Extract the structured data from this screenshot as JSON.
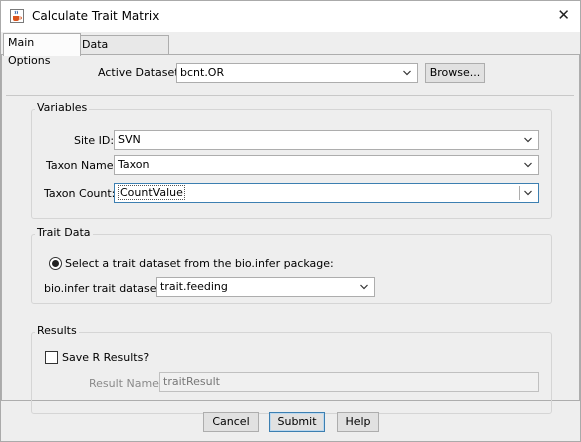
{
  "window": {
    "title": "Calculate Trait Matrix",
    "close_glyph": "✕"
  },
  "tabs": [
    {
      "label": "Main Options",
      "active": true
    },
    {
      "label": "Data Subsetting",
      "active": false
    }
  ],
  "active_dataset": {
    "label": "Active Dataset:",
    "value": "bcnt.OR",
    "browse_label": "Browse..."
  },
  "variables": {
    "title": "Variables",
    "site_id": {
      "label": "Site ID:",
      "value": "SVN"
    },
    "taxon_name": {
      "label": "Taxon Name:",
      "value": "Taxon"
    },
    "taxon_count": {
      "label": "Taxon Count:",
      "value": "CountValue"
    }
  },
  "trait_data": {
    "title": "Trait Data",
    "radio_label": "Select a trait dataset from the bio.infer package:",
    "radio_selected": true,
    "dataset_label": "bio.infer trait dataset:",
    "dataset_value": "trait.feeding"
  },
  "results": {
    "title": "Results",
    "save_label": "Save R Results?",
    "save_checked": false,
    "result_name_label": "Result Name:",
    "result_name_value": "traitResult"
  },
  "buttons": {
    "cancel": "Cancel",
    "submit": "Submit",
    "help": "Help"
  },
  "icons": {
    "app": "java-cup-icon",
    "dropdown": "chevron-down-icon"
  }
}
